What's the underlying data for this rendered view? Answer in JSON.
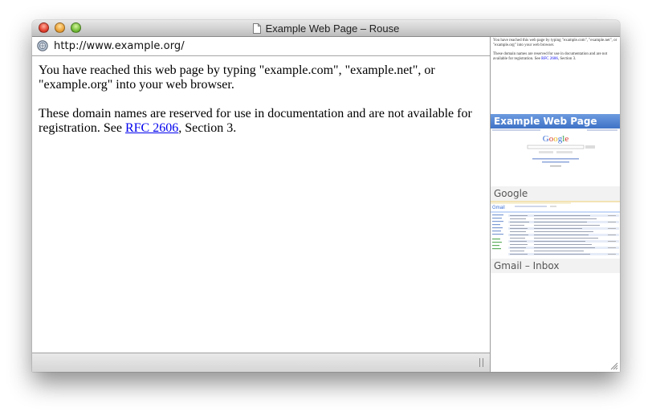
{
  "window": {
    "title": "Example Web Page – Rouse"
  },
  "address_bar": {
    "url": "http://www.example.org/"
  },
  "page": {
    "paragraph1": "You have reached this web page by typing \"example.com\", \"example.net\", or \"example.org\" into your web browser.",
    "paragraph2_before": "These domain names are reserved for use in documentation and are not available for registration. See ",
    "link_text": "RFC 2606",
    "paragraph2_after": ", Section 3."
  },
  "sidebar": {
    "tabs": [
      {
        "label": "Example Web Page",
        "active": true
      },
      {
        "label": "Google",
        "active": false
      },
      {
        "label": "Gmail – Inbox",
        "active": false
      }
    ],
    "google_logo": "Google",
    "gmail_logo": "Gmail"
  },
  "colors": {
    "active_tab": "#3f72c6",
    "link": "#0000ee"
  },
  "icons": [
    "close-icon",
    "minimize-icon",
    "zoom-icon",
    "document-icon",
    "globe-icon",
    "resize-grip-icon"
  ]
}
